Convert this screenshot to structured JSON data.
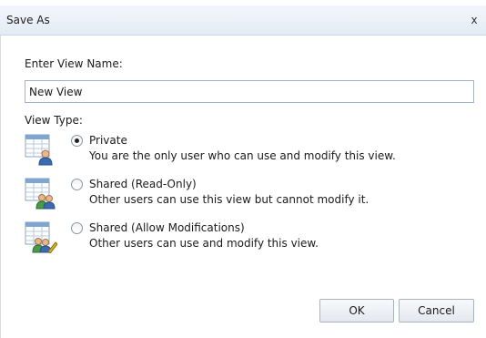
{
  "dialog": {
    "title": "Save As",
    "close_label": "x"
  },
  "form": {
    "name_label": "Enter View Name:",
    "name_value": "New View",
    "type_label": "View Type:"
  },
  "options": [
    {
      "title": "Private",
      "description": "You are the only user who can use and modify this view.",
      "icon": "private-view-icon",
      "checked": true
    },
    {
      "title": "Shared (Read-Only)",
      "description": "Other users can use this view but cannot modify it.",
      "icon": "shared-readonly-view-icon",
      "checked": false
    },
    {
      "title": "Shared (Allow Modifications)",
      "description": "Other users can use and modify this view.",
      "icon": "shared-modify-view-icon",
      "checked": false
    }
  ],
  "buttons": {
    "ok": "OK",
    "cancel": "Cancel"
  }
}
